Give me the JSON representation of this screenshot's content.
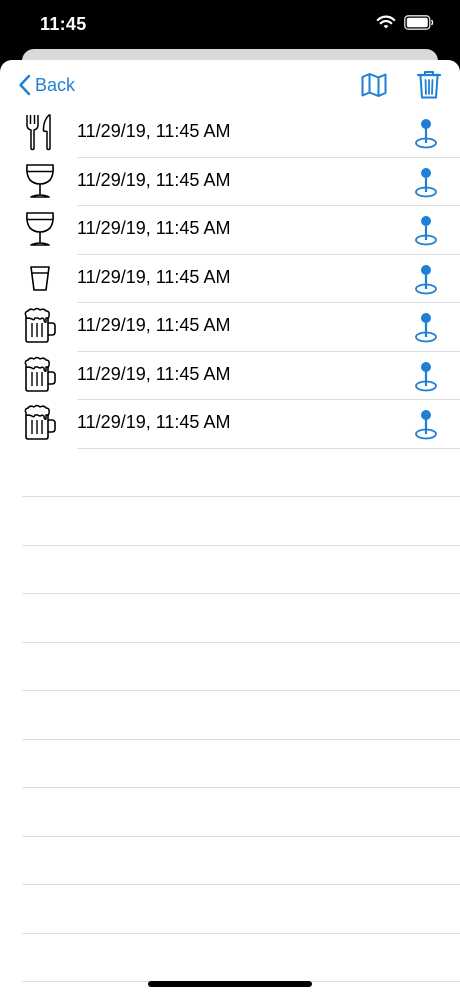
{
  "status_bar": {
    "time": "11:45",
    "icons": [
      "wifi-icon",
      "battery-icon"
    ]
  },
  "nav": {
    "back_label": "Back",
    "back_icon": "chevron-left-icon",
    "map_icon": "map-icon",
    "trash_icon": "trash-icon",
    "accent_color": "#1e7fd6"
  },
  "entries": [
    {
      "icon": "fork-knife-icon",
      "time": "11/29/19, 11:45 AM",
      "action_icon": "location-pin-icon"
    },
    {
      "icon": "wine-glass-icon",
      "time": "11/29/19, 11:45 AM",
      "action_icon": "location-pin-icon"
    },
    {
      "icon": "wine-glass-icon",
      "time": "11/29/19, 11:45 AM",
      "action_icon": "location-pin-icon"
    },
    {
      "icon": "shot-glass-icon",
      "time": "11/29/19, 11:45 AM",
      "action_icon": "location-pin-icon"
    },
    {
      "icon": "beer-mug-icon",
      "time": "11/29/19, 11:45 AM",
      "action_icon": "location-pin-icon"
    },
    {
      "icon": "beer-mug-icon",
      "time": "11/29/19, 11:45 AM",
      "action_icon": "location-pin-icon"
    },
    {
      "icon": "beer-mug-icon",
      "time": "11/29/19, 11:45 AM",
      "action_icon": "location-pin-icon"
    }
  ]
}
